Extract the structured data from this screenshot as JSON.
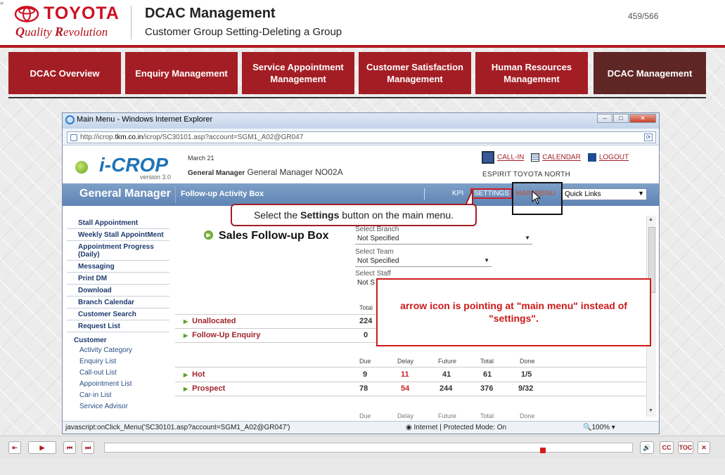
{
  "header": {
    "brand": "TOYOTA",
    "tagline_q": "Q",
    "tagline_rest": "uality ",
    "tagline_r": "R",
    "tagline_end": "evolution",
    "title": "DCAC Management",
    "subtitle": "Customer Group Setting-Deleting a Group",
    "page_counter": "459/566"
  },
  "nav_tabs": [
    {
      "label": "DCAC Overview",
      "active": false
    },
    {
      "label": "Enquiry Management",
      "active": false
    },
    {
      "label": "Service Appointment Management",
      "active": false
    },
    {
      "label": "Customer Satisfaction Management",
      "active": false
    },
    {
      "label": "Human Resources Management",
      "active": false
    },
    {
      "label": "DCAC Management",
      "active": true
    }
  ],
  "browser": {
    "window_title": "Main Menu  - Windows Internet Explorer",
    "url_prefix": "http://icrop.",
    "url_domain": "tkm.co.in",
    "url_path": "/icrop/SC30101.asp?account=SGM1_A02@GR047",
    "status_js": "javascript:onClick_Menu('SC30101.asp?account=SGM1_A02@GR047')",
    "status_zone": "Internet | Protected Mode: On",
    "zoom": "100%"
  },
  "app": {
    "logo_text": "i-CROP",
    "version": "version 3.0",
    "date": "March 21",
    "role_label": "General Manager",
    "user_name": "General Manager NO02A",
    "call_in": "CALL-IN",
    "calendar": "CALENDAR",
    "logout": "LOGOUT",
    "dealer": "ESPIRIT TOYOTA NORTH",
    "bar_title": "General Manager",
    "bar_subtitle": "Follow-up Activity Box",
    "kpi": "KPI",
    "settings": "SETTINGS",
    "main_menu": "MAIN MENU",
    "quick_links": "Quick Links"
  },
  "left_menu": {
    "items": [
      "Stall Appointment",
      "Weekly Stall AppointMent",
      "Appointment Progress (Daily)",
      "Messaging",
      "Print DM",
      "Download",
      "Branch Calendar",
      "Customer Search",
      "Request List"
    ],
    "section": "Customer",
    "sub_items": [
      "Activity Category",
      "Enquiry List",
      "Call-out List",
      "Appointment List",
      "Car-in List",
      "Service Advisor"
    ]
  },
  "content": {
    "title": "Sales Follow-up Box",
    "select_branch_label": "Select Branch",
    "select_branch_value": "Not Specified",
    "select_team_label": "Select Team",
    "select_team_value": "Not Specified",
    "select_staff_label": "Select Staff",
    "select_staff_value": "Not S",
    "total_header": "Total",
    "rows_top": [
      {
        "label": "Unallocated",
        "total": "224"
      },
      {
        "label": "Follow-Up Enquiry",
        "total": "0"
      }
    ],
    "col_headers": [
      "Due",
      "Delay",
      "Future",
      "Total",
      "Done"
    ],
    "rows": [
      {
        "label": "Hot",
        "due": "9",
        "delay": "11",
        "future": "41",
        "total": "61",
        "done": "1/5"
      },
      {
        "label": "Prospect",
        "due": "78",
        "delay": "54",
        "future": "244",
        "total": "376",
        "done": "9/32"
      }
    ]
  },
  "callout": {
    "pre": "Select the ",
    "bold": "Settings",
    "post": " button on the main menu."
  },
  "note": "arrow icon is pointing at \"main menu\" instead of \"settings\".",
  "player": {
    "cc": "CC",
    "toc": "TOC",
    "close": "✕",
    "progress": 0.83
  },
  "colors": {
    "toyota_red": "#cc1122",
    "nav_red": "#a31e24",
    "nav_active": "#5e2726",
    "app_blue_bar": "#6a8fbe"
  }
}
